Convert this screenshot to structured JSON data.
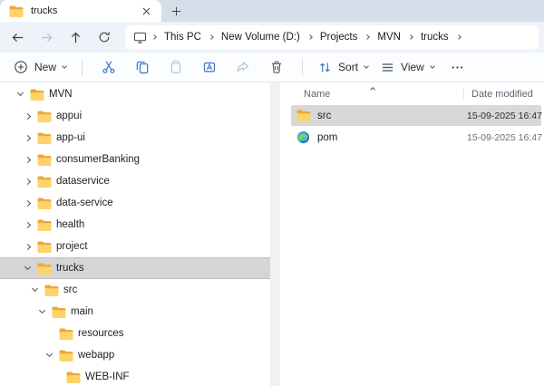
{
  "tabbar": {
    "active_tab": "trucks"
  },
  "breadcrumb": {
    "items": [
      "This PC",
      "New Volume (D:)",
      "Projects",
      "MVN",
      "trucks"
    ]
  },
  "toolbar": {
    "new_label": "New",
    "sort_label": "Sort",
    "view_label": "View"
  },
  "tree": {
    "items": [
      {
        "label": "MVN",
        "level": 0,
        "state": "expanded",
        "selected": false
      },
      {
        "label": "appui",
        "level": 1,
        "state": "collapsed",
        "selected": false
      },
      {
        "label": "app-ui",
        "level": 1,
        "state": "collapsed",
        "selected": false
      },
      {
        "label": "consumerBanking",
        "level": 1,
        "state": "collapsed",
        "selected": false
      },
      {
        "label": "dataservice",
        "level": 1,
        "state": "collapsed",
        "selected": false
      },
      {
        "label": "data-service",
        "level": 1,
        "state": "collapsed",
        "selected": false
      },
      {
        "label": "health",
        "level": 1,
        "state": "collapsed",
        "selected": false
      },
      {
        "label": "project",
        "level": 1,
        "state": "collapsed",
        "selected": false
      },
      {
        "label": "trucks",
        "level": 1,
        "state": "expanded",
        "selected": true
      },
      {
        "label": "src",
        "level": 2,
        "state": "expanded",
        "selected": false
      },
      {
        "label": "main",
        "level": 3,
        "state": "expanded",
        "selected": false
      },
      {
        "label": "resources",
        "level": 4,
        "state": "leaf",
        "selected": false
      },
      {
        "label": "webapp",
        "level": 4,
        "state": "expanded",
        "selected": false
      },
      {
        "label": "WEB-INF",
        "level": 5,
        "state": "leaf",
        "selected": false
      }
    ]
  },
  "files": {
    "columns": {
      "name": "Name",
      "date": "Date modified"
    },
    "rows": [
      {
        "name": "src",
        "icon": "folder",
        "date": "15-09-2025 16:47",
        "selected": true
      },
      {
        "name": "pom",
        "icon": "edge",
        "date": "15-09-2025 16:47",
        "selected": false
      }
    ]
  },
  "colors": {
    "accent_icon_blue": "#3776c5",
    "disabled_icon": "#b9c6d6",
    "folder_back": "#eda73e",
    "folder_front": "#ffd36a",
    "tabbar_bg": "#d4dfe9",
    "navbar_bg": "#edf3f9",
    "selection_gray": "#d5d5d5"
  }
}
